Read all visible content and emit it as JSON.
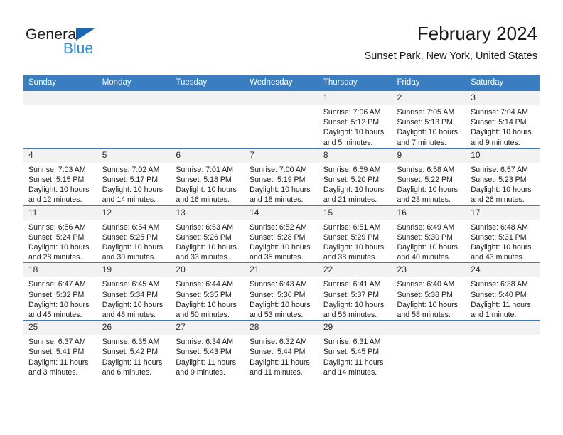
{
  "brand": {
    "name_top": "General",
    "name_bottom": "Blue",
    "color_dark": "#231f20",
    "color_blue": "#2e8ad5",
    "triangle_color": "#1668b3"
  },
  "header": {
    "title": "February 2024",
    "subtitle": "Sunset Park, New York, United States"
  },
  "theme": {
    "header_row_bg": "#3a7dc0",
    "daynum_bg": "#f2f2f2",
    "grid_line": "#3a7dc0",
    "text": "#1c1c1c"
  },
  "weekdays": [
    "Sunday",
    "Monday",
    "Tuesday",
    "Wednesday",
    "Thursday",
    "Friday",
    "Saturday"
  ],
  "weeks": [
    [
      {
        "day": "",
        "empty": true
      },
      {
        "day": "",
        "empty": true
      },
      {
        "day": "",
        "empty": true
      },
      {
        "day": "",
        "empty": true
      },
      {
        "day": "1",
        "sunrise": "Sunrise: 7:06 AM",
        "sunset": "Sunset: 5:12 PM",
        "daylight": "Daylight: 10 hours and 5 minutes."
      },
      {
        "day": "2",
        "sunrise": "Sunrise: 7:05 AM",
        "sunset": "Sunset: 5:13 PM",
        "daylight": "Daylight: 10 hours and 7 minutes."
      },
      {
        "day": "3",
        "sunrise": "Sunrise: 7:04 AM",
        "sunset": "Sunset: 5:14 PM",
        "daylight": "Daylight: 10 hours and 9 minutes."
      }
    ],
    [
      {
        "day": "4",
        "sunrise": "Sunrise: 7:03 AM",
        "sunset": "Sunset: 5:15 PM",
        "daylight": "Daylight: 10 hours and 12 minutes."
      },
      {
        "day": "5",
        "sunrise": "Sunrise: 7:02 AM",
        "sunset": "Sunset: 5:17 PM",
        "daylight": "Daylight: 10 hours and 14 minutes."
      },
      {
        "day": "6",
        "sunrise": "Sunrise: 7:01 AM",
        "sunset": "Sunset: 5:18 PM",
        "daylight": "Daylight: 10 hours and 16 minutes."
      },
      {
        "day": "7",
        "sunrise": "Sunrise: 7:00 AM",
        "sunset": "Sunset: 5:19 PM",
        "daylight": "Daylight: 10 hours and 18 minutes."
      },
      {
        "day": "8",
        "sunrise": "Sunrise: 6:59 AM",
        "sunset": "Sunset: 5:20 PM",
        "daylight": "Daylight: 10 hours and 21 minutes."
      },
      {
        "day": "9",
        "sunrise": "Sunrise: 6:58 AM",
        "sunset": "Sunset: 5:22 PM",
        "daylight": "Daylight: 10 hours and 23 minutes."
      },
      {
        "day": "10",
        "sunrise": "Sunrise: 6:57 AM",
        "sunset": "Sunset: 5:23 PM",
        "daylight": "Daylight: 10 hours and 26 minutes."
      }
    ],
    [
      {
        "day": "11",
        "sunrise": "Sunrise: 6:56 AM",
        "sunset": "Sunset: 5:24 PM",
        "daylight": "Daylight: 10 hours and 28 minutes."
      },
      {
        "day": "12",
        "sunrise": "Sunrise: 6:54 AM",
        "sunset": "Sunset: 5:25 PM",
        "daylight": "Daylight: 10 hours and 30 minutes."
      },
      {
        "day": "13",
        "sunrise": "Sunrise: 6:53 AM",
        "sunset": "Sunset: 5:26 PM",
        "daylight": "Daylight: 10 hours and 33 minutes."
      },
      {
        "day": "14",
        "sunrise": "Sunrise: 6:52 AM",
        "sunset": "Sunset: 5:28 PM",
        "daylight": "Daylight: 10 hours and 35 minutes."
      },
      {
        "day": "15",
        "sunrise": "Sunrise: 6:51 AM",
        "sunset": "Sunset: 5:29 PM",
        "daylight": "Daylight: 10 hours and 38 minutes."
      },
      {
        "day": "16",
        "sunrise": "Sunrise: 6:49 AM",
        "sunset": "Sunset: 5:30 PM",
        "daylight": "Daylight: 10 hours and 40 minutes."
      },
      {
        "day": "17",
        "sunrise": "Sunrise: 6:48 AM",
        "sunset": "Sunset: 5:31 PM",
        "daylight": "Daylight: 10 hours and 43 minutes."
      }
    ],
    [
      {
        "day": "18",
        "sunrise": "Sunrise: 6:47 AM",
        "sunset": "Sunset: 5:32 PM",
        "daylight": "Daylight: 10 hours and 45 minutes."
      },
      {
        "day": "19",
        "sunrise": "Sunrise: 6:45 AM",
        "sunset": "Sunset: 5:34 PM",
        "daylight": "Daylight: 10 hours and 48 minutes."
      },
      {
        "day": "20",
        "sunrise": "Sunrise: 6:44 AM",
        "sunset": "Sunset: 5:35 PM",
        "daylight": "Daylight: 10 hours and 50 minutes."
      },
      {
        "day": "21",
        "sunrise": "Sunrise: 6:43 AM",
        "sunset": "Sunset: 5:36 PM",
        "daylight": "Daylight: 10 hours and 53 minutes."
      },
      {
        "day": "22",
        "sunrise": "Sunrise: 6:41 AM",
        "sunset": "Sunset: 5:37 PM",
        "daylight": "Daylight: 10 hours and 56 minutes."
      },
      {
        "day": "23",
        "sunrise": "Sunrise: 6:40 AM",
        "sunset": "Sunset: 5:38 PM",
        "daylight": "Daylight: 10 hours and 58 minutes."
      },
      {
        "day": "24",
        "sunrise": "Sunrise: 6:38 AM",
        "sunset": "Sunset: 5:40 PM",
        "daylight": "Daylight: 11 hours and 1 minute."
      }
    ],
    [
      {
        "day": "25",
        "sunrise": "Sunrise: 6:37 AM",
        "sunset": "Sunset: 5:41 PM",
        "daylight": "Daylight: 11 hours and 3 minutes."
      },
      {
        "day": "26",
        "sunrise": "Sunrise: 6:35 AM",
        "sunset": "Sunset: 5:42 PM",
        "daylight": "Daylight: 11 hours and 6 minutes."
      },
      {
        "day": "27",
        "sunrise": "Sunrise: 6:34 AM",
        "sunset": "Sunset: 5:43 PM",
        "daylight": "Daylight: 11 hours and 9 minutes."
      },
      {
        "day": "28",
        "sunrise": "Sunrise: 6:32 AM",
        "sunset": "Sunset: 5:44 PM",
        "daylight": "Daylight: 11 hours and 11 minutes."
      },
      {
        "day": "29",
        "sunrise": "Sunrise: 6:31 AM",
        "sunset": "Sunset: 5:45 PM",
        "daylight": "Daylight: 11 hours and 14 minutes."
      },
      {
        "day": "",
        "empty": true
      },
      {
        "day": "",
        "empty": true
      }
    ]
  ]
}
